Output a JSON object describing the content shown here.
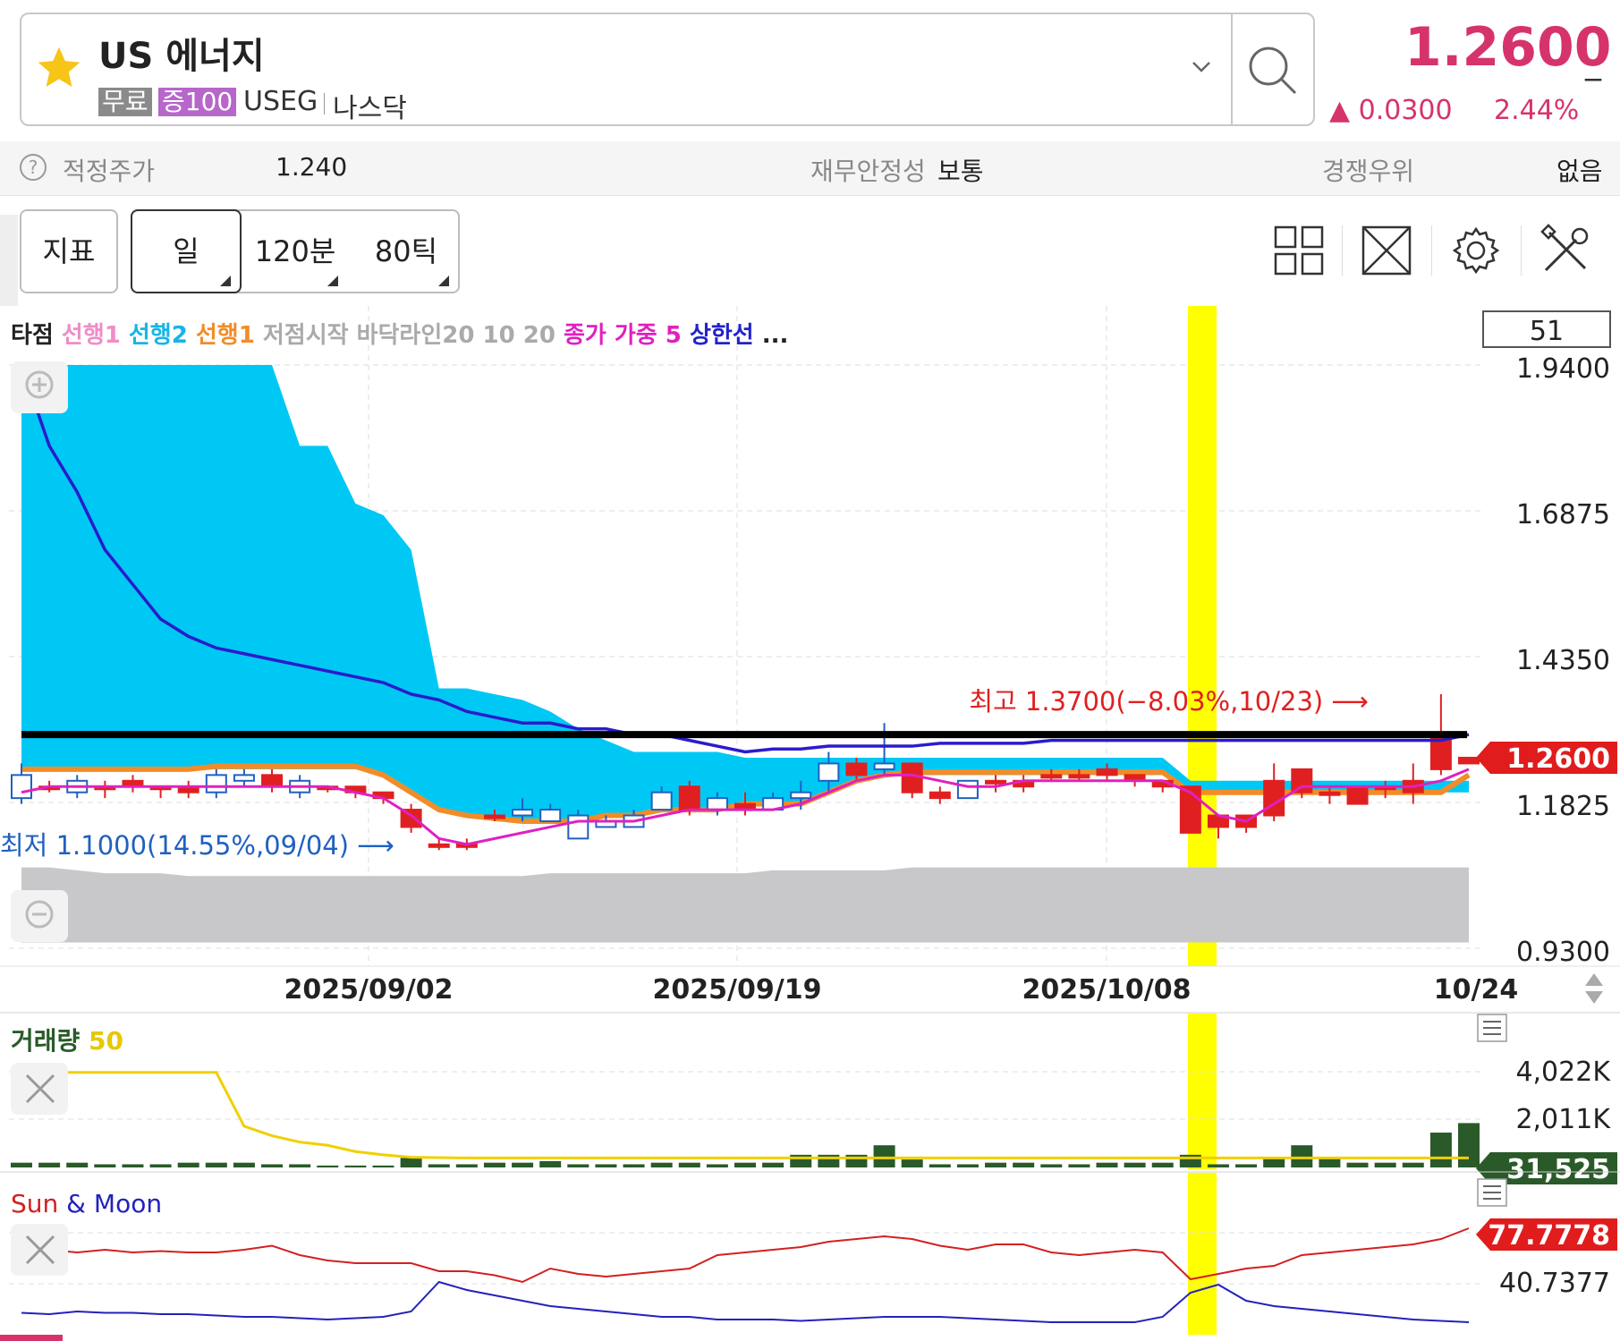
{
  "header": {
    "name": "US 에너지",
    "tag_free": "무료",
    "tag_margin": "증100",
    "ticker": "USEG",
    "exchange": "나스닥",
    "price": "1.2600",
    "price_dash": "_",
    "change": "▲ 0.0300",
    "change_pct": "2.44%",
    "price_color": "#d6336c"
  },
  "info": {
    "fair_label": "적정주가",
    "fair_value": "1.240",
    "fin_label": "재무안정성",
    "fin_value": "보통",
    "comp_label": "경쟁우위",
    "comp_value": "없음"
  },
  "toolbar": {
    "indicator": "지표",
    "day": "일",
    "min120": "120분",
    "tick80": "80틱",
    "icons": [
      "grid-layout-icon",
      "fullscreen-icon",
      "settings-gear-icon",
      "tools-icon"
    ]
  },
  "chart_data": [
    {
      "type": "candlestick",
      "legend": [
        {
          "text": "타점",
          "color": "#222222"
        },
        {
          "text": "선행1",
          "color": "#f08cc8"
        },
        {
          "text": "선행2",
          "color": "#17b4e6"
        },
        {
          "text": "선행1",
          "color": "#f28c28"
        },
        {
          "text": "저점시작",
          "color": "#aaaaaa"
        },
        {
          "text": "바닥라인20",
          "color": "#aaaaaa"
        },
        {
          "text": "10",
          "color": "#aaaaaa"
        },
        {
          "text": "20",
          "color": "#aaaaaa"
        },
        {
          "text": "종가",
          "color": "#e020c0"
        },
        {
          "text": "가중",
          "color": "#e020c0"
        },
        {
          "text": "5",
          "color": "#e020c0"
        },
        {
          "text": "상한선",
          "color": "#2222cc"
        },
        {
          "text": "...",
          "color": "#222222"
        }
      ],
      "count_box": "51",
      "y_ticks": [
        "1.9400",
        "1.6875",
        "1.4350",
        "1.1825",
        "0.9300"
      ],
      "y_range": [
        0.93,
        1.94
      ],
      "x_ticks": [
        "2025/09/02",
        "2025/09/19",
        "2025/10/08",
        "10/24"
      ],
      "current_price_label": "1.2600",
      "high_annotation": "최고 1.3700(−8.03%,10/23) ⟶",
      "low_annotation": "최저 1.1000(14.55%,09/04) ⟶",
      "horizontal_line": 1.3,
      "candles": [
        {
          "o": 1.23,
          "h": 1.25,
          "l": 1.18,
          "c": 1.19
        },
        {
          "o": 1.21,
          "h": 1.22,
          "l": 1.2,
          "c": 1.21
        },
        {
          "o": 1.22,
          "h": 1.23,
          "l": 1.19,
          "c": 1.2
        },
        {
          "o": 1.21,
          "h": 1.22,
          "l": 1.19,
          "c": 1.21
        },
        {
          "o": 1.21,
          "h": 1.23,
          "l": 1.2,
          "c": 1.22
        },
        {
          "o": 1.21,
          "h": 1.21,
          "l": 1.19,
          "c": 1.21
        },
        {
          "o": 1.2,
          "h": 1.22,
          "l": 1.19,
          "c": 1.21
        },
        {
          "o": 1.23,
          "h": 1.24,
          "l": 1.19,
          "c": 1.2
        },
        {
          "o": 1.23,
          "h": 1.24,
          "l": 1.21,
          "c": 1.22
        },
        {
          "o": 1.21,
          "h": 1.24,
          "l": 1.2,
          "c": 1.23
        },
        {
          "o": 1.22,
          "h": 1.23,
          "l": 1.19,
          "c": 1.2
        },
        {
          "o": 1.21,
          "h": 1.21,
          "l": 1.2,
          "c": 1.21
        },
        {
          "o": 1.2,
          "h": 1.21,
          "l": 1.19,
          "c": 1.21
        },
        {
          "o": 1.19,
          "h": 1.2,
          "l": 1.18,
          "c": 1.2
        },
        {
          "o": 1.14,
          "h": 1.18,
          "l": 1.13,
          "c": 1.17
        },
        {
          "o": 1.11,
          "h": 1.12,
          "l": 1.1,
          "c": 1.11
        },
        {
          "o": 1.11,
          "h": 1.12,
          "l": 1.1,
          "c": 1.11
        },
        {
          "o": 1.16,
          "h": 1.17,
          "l": 1.15,
          "c": 1.16
        },
        {
          "o": 1.17,
          "h": 1.19,
          "l": 1.15,
          "c": 1.16
        },
        {
          "o": 1.17,
          "h": 1.18,
          "l": 1.15,
          "c": 1.15
        },
        {
          "o": 1.16,
          "h": 1.17,
          "l": 1.14,
          "c": 1.12
        },
        {
          "o": 1.15,
          "h": 1.16,
          "l": 1.14,
          "c": 1.14
        },
        {
          "o": 1.16,
          "h": 1.17,
          "l": 1.14,
          "c": 1.14
        },
        {
          "o": 1.2,
          "h": 1.21,
          "l": 1.17,
          "c": 1.17
        },
        {
          "o": 1.17,
          "h": 1.22,
          "l": 1.16,
          "c": 1.21
        },
        {
          "o": 1.19,
          "h": 1.2,
          "l": 1.16,
          "c": 1.17
        },
        {
          "o": 1.17,
          "h": 1.2,
          "l": 1.16,
          "c": 1.18
        },
        {
          "o": 1.19,
          "h": 1.2,
          "l": 1.17,
          "c": 1.17
        },
        {
          "o": 1.2,
          "h": 1.22,
          "l": 1.17,
          "c": 1.19
        },
        {
          "o": 1.25,
          "h": 1.27,
          "l": 1.2,
          "c": 1.22
        },
        {
          "o": 1.23,
          "h": 1.26,
          "l": 1.22,
          "c": 1.25
        },
        {
          "o": 1.25,
          "h": 1.32,
          "l": 1.23,
          "c": 1.24
        },
        {
          "o": 1.2,
          "h": 1.25,
          "l": 1.19,
          "c": 1.25
        },
        {
          "o": 1.19,
          "h": 1.21,
          "l": 1.18,
          "c": 1.2
        },
        {
          "o": 1.22,
          "h": 1.22,
          "l": 1.19,
          "c": 1.19
        },
        {
          "o": 1.22,
          "h": 1.23,
          "l": 1.2,
          "c": 1.22
        },
        {
          "o": 1.21,
          "h": 1.23,
          "l": 1.2,
          "c": 1.22
        },
        {
          "o": 1.23,
          "h": 1.24,
          "l": 1.22,
          "c": 1.23
        },
        {
          "o": 1.23,
          "h": 1.24,
          "l": 1.22,
          "c": 1.23
        },
        {
          "o": 1.23,
          "h": 1.25,
          "l": 1.22,
          "c": 1.24
        },
        {
          "o": 1.22,
          "h": 1.23,
          "l": 1.21,
          "c": 1.23
        },
        {
          "o": 1.21,
          "h": 1.22,
          "l": 1.2,
          "c": 1.22
        },
        {
          "o": 1.13,
          "h": 1.21,
          "l": 1.13,
          "c": 1.21
        },
        {
          "o": 1.14,
          "h": 1.16,
          "l": 1.12,
          "c": 1.16
        },
        {
          "o": 1.14,
          "h": 1.16,
          "l": 1.13,
          "c": 1.16
        },
        {
          "o": 1.16,
          "h": 1.25,
          "l": 1.15,
          "c": 1.22
        },
        {
          "o": 1.2,
          "h": 1.24,
          "l": 1.19,
          "c": 1.24
        },
        {
          "o": 1.2,
          "h": 1.21,
          "l": 1.18,
          "c": 1.2
        },
        {
          "o": 1.18,
          "h": 1.21,
          "l": 1.18,
          "c": 1.21
        },
        {
          "o": 1.21,
          "h": 1.22,
          "l": 1.19,
          "c": 1.21
        },
        {
          "o": 1.2,
          "h": 1.25,
          "l": 1.18,
          "c": 1.22
        },
        {
          "o": 1.24,
          "h": 1.37,
          "l": 1.23,
          "c": 1.3
        },
        {
          "o": 1.25,
          "h": 1.26,
          "l": 1.25,
          "c": 1.26
        }
      ],
      "cloud_upper": [
        1.94,
        1.94,
        1.94,
        1.94,
        1.94,
        1.94,
        1.94,
        1.94,
        1.94,
        1.94,
        1.8,
        1.8,
        1.7,
        1.68,
        1.62,
        1.38,
        1.38,
        1.37,
        1.36,
        1.34,
        1.31,
        1.29,
        1.27,
        1.27,
        1.27,
        1.27,
        1.26,
        1.26,
        1.26,
        1.26,
        1.26,
        1.26,
        1.26,
        1.26,
        1.26,
        1.26,
        1.26,
        1.26,
        1.26,
        1.26,
        1.26,
        1.26,
        1.22,
        1.22,
        1.22,
        1.22,
        1.22,
        1.22,
        1.22,
        1.22,
        1.22,
        1.22,
        1.22
      ],
      "cloud_lower": [
        1.24,
        1.24,
        1.24,
        1.24,
        1.24,
        1.24,
        1.24,
        1.24,
        1.24,
        1.24,
        1.24,
        1.24,
        1.24,
        1.23,
        1.2,
        1.17,
        1.16,
        1.15,
        1.15,
        1.15,
        1.15,
        1.16,
        1.16,
        1.17,
        1.17,
        1.17,
        1.18,
        1.18,
        1.18,
        1.2,
        1.22,
        1.23,
        1.23,
        1.23,
        1.23,
        1.23,
        1.23,
        1.23,
        1.23,
        1.23,
        1.23,
        1.23,
        1.2,
        1.2,
        1.2,
        1.2,
        1.2,
        1.2,
        1.2,
        1.2,
        1.2,
        1.2,
        1.2
      ],
      "orange_line": [
        1.24,
        1.24,
        1.24,
        1.24,
        1.24,
        1.24,
        1.24,
        1.245,
        1.245,
        1.245,
        1.245,
        1.245,
        1.245,
        1.23,
        1.2,
        1.17,
        1.16,
        1.155,
        1.15,
        1.15,
        1.15,
        1.16,
        1.16,
        1.17,
        1.17,
        1.17,
        1.18,
        1.18,
        1.18,
        1.2,
        1.22,
        1.23,
        1.235,
        1.235,
        1.235,
        1.235,
        1.235,
        1.235,
        1.235,
        1.235,
        1.235,
        1.235,
        1.2,
        1.2,
        1.2,
        1.2,
        1.2,
        1.2,
        1.2,
        1.2,
        1.2,
        1.2,
        1.23
      ],
      "magenta_line": [
        1.2,
        1.21,
        1.21,
        1.21,
        1.21,
        1.21,
        1.21,
        1.21,
        1.21,
        1.21,
        1.21,
        1.21,
        1.2,
        1.19,
        1.16,
        1.12,
        1.11,
        1.12,
        1.13,
        1.14,
        1.15,
        1.15,
        1.15,
        1.16,
        1.17,
        1.17,
        1.17,
        1.17,
        1.18,
        1.2,
        1.22,
        1.23,
        1.23,
        1.22,
        1.21,
        1.21,
        1.22,
        1.22,
        1.22,
        1.22,
        1.22,
        1.22,
        1.2,
        1.16,
        1.15,
        1.18,
        1.21,
        1.21,
        1.21,
        1.21,
        1.21,
        1.22,
        1.24
      ],
      "blue_line": [
        1.94,
        1.8,
        1.72,
        1.62,
        1.56,
        1.5,
        1.47,
        1.45,
        1.44,
        1.43,
        1.42,
        1.41,
        1.4,
        1.39,
        1.37,
        1.36,
        1.34,
        1.33,
        1.32,
        1.32,
        1.31,
        1.31,
        1.3,
        1.3,
        1.29,
        1.28,
        1.27,
        1.275,
        1.275,
        1.28,
        1.28,
        1.28,
        1.28,
        1.285,
        1.285,
        1.285,
        1.285,
        1.29,
        1.29,
        1.29,
        1.29,
        1.29,
        1.29,
        1.29,
        1.29,
        1.29,
        1.29,
        1.29,
        1.29,
        1.29,
        1.29,
        1.29,
        1.3
      ],
      "gray_band_top": [
        1.07,
        1.07,
        1.065,
        1.06,
        1.06,
        1.06,
        1.055,
        1.055,
        1.055,
        1.055,
        1.055,
        1.055,
        1.055,
        1.055,
        1.055,
        1.055,
        1.055,
        1.055,
        1.055,
        1.06,
        1.06,
        1.06,
        1.06,
        1.06,
        1.06,
        1.06,
        1.06,
        1.065,
        1.065,
        1.065,
        1.065,
        1.065,
        1.07,
        1.07,
        1.07,
        1.07,
        1.07,
        1.07,
        1.07,
        1.07,
        1.07,
        1.07,
        1.07,
        1.07,
        1.07,
        1.07,
        1.07,
        1.07,
        1.07,
        1.07,
        1.07,
        1.07,
        1.07
      ],
      "gray_band_bottom": [
        0.94,
        0.94,
        0.94,
        0.94,
        0.94,
        0.94,
        0.94,
        0.94,
        0.94,
        0.94,
        0.94,
        0.94,
        0.94,
        0.94,
        0.94,
        0.94,
        0.94,
        0.94,
        0.94,
        0.94,
        0.94,
        0.94,
        0.94,
        0.94,
        0.94,
        0.94,
        0.94,
        0.94,
        0.94,
        0.94,
        0.94,
        0.94,
        0.94,
        0.94,
        0.94,
        0.94,
        0.94,
        0.94,
        0.94,
        0.94,
        0.94,
        0.94,
        0.94,
        0.94,
        0.94,
        0.94,
        0.94,
        0.94,
        0.94,
        0.94,
        0.94,
        0.94,
        0.94
      ],
      "highlight_index": 41
    },
    {
      "type": "bar",
      "title": "거래량",
      "title_param": "50",
      "y_ticks": [
        "4,022K",
        "2,011K"
      ],
      "y_range": [
        0,
        4800
      ],
      "current_label": "31,525",
      "volumes": [
        150,
        150,
        150,
        100,
        100,
        100,
        150,
        150,
        150,
        100,
        100,
        60,
        60,
        60,
        300,
        100,
        100,
        150,
        150,
        200,
        100,
        100,
        100,
        150,
        150,
        100,
        150,
        150,
        400,
        400,
        400,
        700,
        250,
        100,
        100,
        150,
        150,
        100,
        100,
        150,
        150,
        150,
        400,
        100,
        100,
        300,
        700,
        300,
        150,
        150,
        150,
        1100,
        1400
      ],
      "volume_ma": [
        3000,
        3000,
        3000,
        3000,
        3000,
        3000,
        3000,
        3000,
        1300,
        1000,
        800,
        700,
        500,
        400,
        320,
        310,
        300,
        300,
        300,
        300,
        300,
        300,
        300,
        300,
        300,
        300,
        300,
        300,
        300,
        300,
        300,
        300,
        300,
        300,
        300,
        300,
        300,
        300,
        300,
        300,
        300,
        300,
        300,
        300,
        300,
        300,
        300,
        300,
        300,
        300,
        300,
        300,
        300
      ]
    },
    {
      "type": "line",
      "title_sun": "Sun",
      "title_amp": "&",
      "title_moon": "Moon",
      "y_ticks": [
        "40.7377"
      ],
      "current_label": "77.7778",
      "y_range": [
        0,
        100
      ],
      "sun": [
        60,
        62,
        60,
        62,
        60,
        61,
        60,
        60,
        62,
        65,
        58,
        54,
        52,
        52,
        52,
        46,
        46,
        43,
        38,
        48,
        44,
        42,
        44,
        46,
        48,
        58,
        60,
        62,
        64,
        68,
        70,
        72,
        70,
        65,
        62,
        66,
        66,
        60,
        58,
        60,
        62,
        60,
        40,
        44,
        48,
        50,
        58,
        60,
        62,
        64,
        66,
        70,
        78
      ],
      "moon": [
        15,
        14,
        16,
        15,
        15,
        14,
        14,
        13,
        12,
        12,
        11,
        10,
        11,
        12,
        16,
        38,
        32,
        28,
        24,
        20,
        18,
        16,
        14,
        12,
        12,
        10,
        10,
        10,
        9,
        10,
        11,
        12,
        12,
        12,
        11,
        10,
        9,
        8,
        8,
        8,
        8,
        12,
        30,
        36,
        24,
        20,
        18,
        16,
        14,
        12,
        10,
        9,
        8
      ]
    }
  ]
}
